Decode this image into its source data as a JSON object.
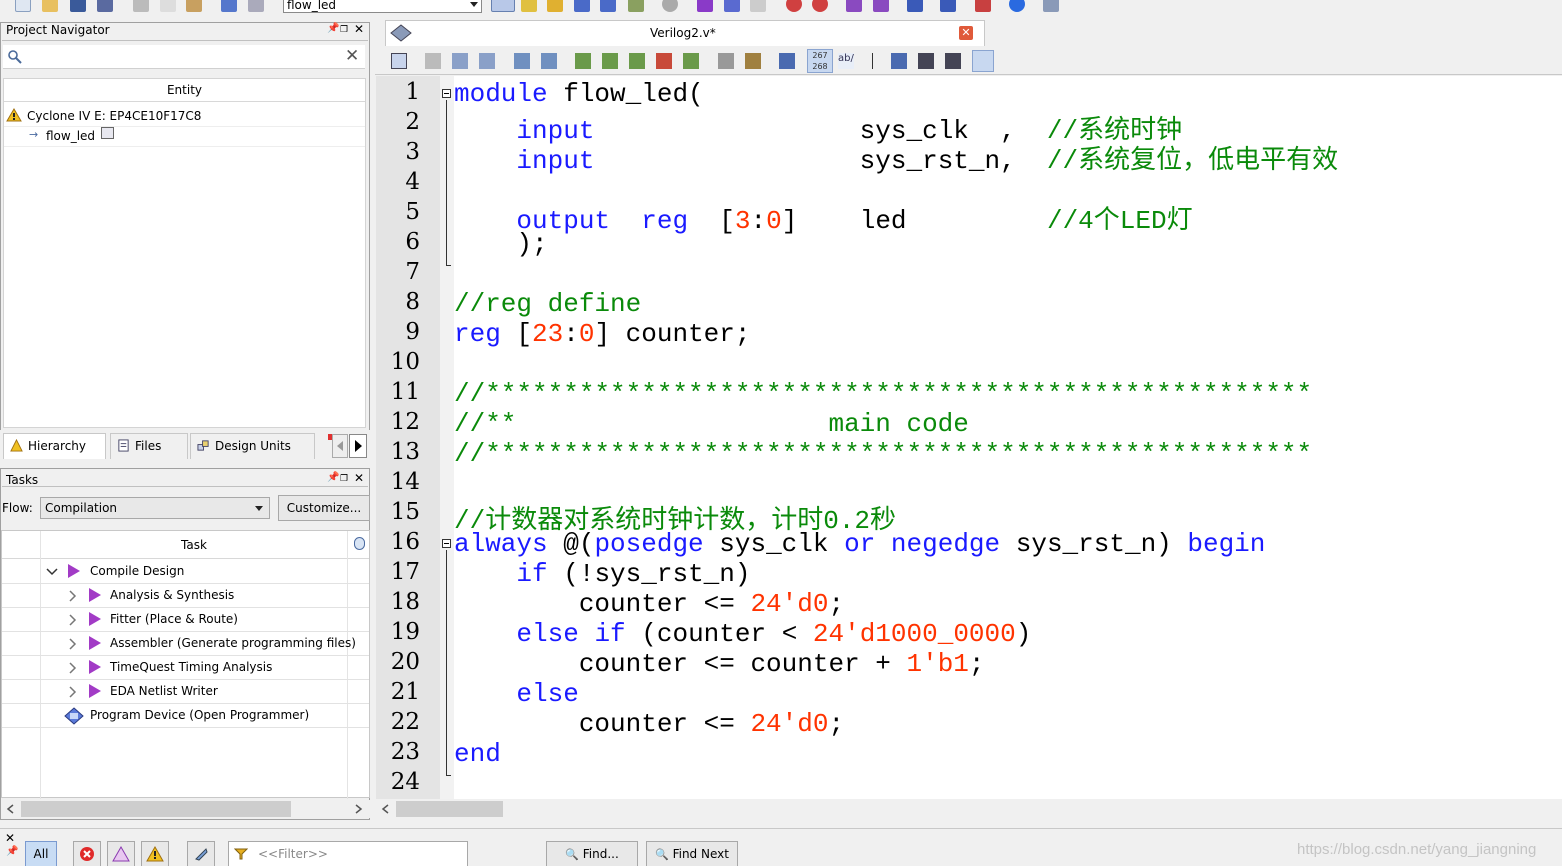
{
  "toolbar": {
    "project_selector": "flow_led"
  },
  "project_navigator": {
    "title": "Project Navigator",
    "column_header": "Entity",
    "device": "Cyclone IV E: EP4CE10F17C8",
    "top_entity": "flow_led",
    "tabs": [
      "Hierarchy",
      "Files",
      "Design Units"
    ]
  },
  "tasks": {
    "title": "Tasks",
    "flow_label": "Flow:",
    "flow_value": "Compilation",
    "customize_button": "Customize...",
    "column_header": "Task",
    "items": [
      "Compile Design",
      "Analysis & Synthesis",
      "Fitter (Place & Route)",
      "Assembler (Generate programming files)",
      "TimeQuest Timing Analysis",
      "EDA Netlist Writer",
      "Program Device (Open Programmer)"
    ]
  },
  "editor": {
    "tab_title": "Verilog2.v*",
    "line_numbers": [
      "1",
      "2",
      "3",
      "4",
      "5",
      "6",
      "7",
      "8",
      "9",
      "10",
      "11",
      "12",
      "13",
      "14",
      "15",
      "16",
      "17",
      "18",
      "19",
      "20",
      "21",
      "22",
      "23",
      "24"
    ],
    "lines": [
      "module flow_led(",
      "    input                 sys_clk  ,  //系统时钟",
      "    input                 sys_rst_n,  //系统复位，低电平有效",
      "",
      "    output  reg  [3:0]    led         //4个LED灯",
      "    );",
      "",
      "//reg define",
      "reg [23:0] counter;",
      "",
      "//*****************************************************",
      "//**                    main code",
      "//*****************************************************",
      "",
      "//计数器对系统时钟计数，计时0.2秒",
      "always @(posedge sys_clk or negedge sys_rst_n) begin",
      "    if (!sys_rst_n)",
      "        counter <= 24'd0;",
      "    else if (counter < 24'd1000_0000)",
      "        counter <= counter + 1'b1;",
      "    else",
      "        counter <= 24'd0;",
      "end",
      ""
    ]
  },
  "messages_bar": {
    "all_button": "All",
    "filter_placeholder": "<<Filter>>",
    "find_button": "Find...",
    "find_next_button": "Find Next",
    "watermark": "https://blog.csdn.net/yang_jiangning"
  },
  "colors": {
    "keyword": "#1a1aff",
    "comment": "#0a8a0a",
    "number": "#ff3300",
    "task_arrow": "#a23bc6"
  }
}
